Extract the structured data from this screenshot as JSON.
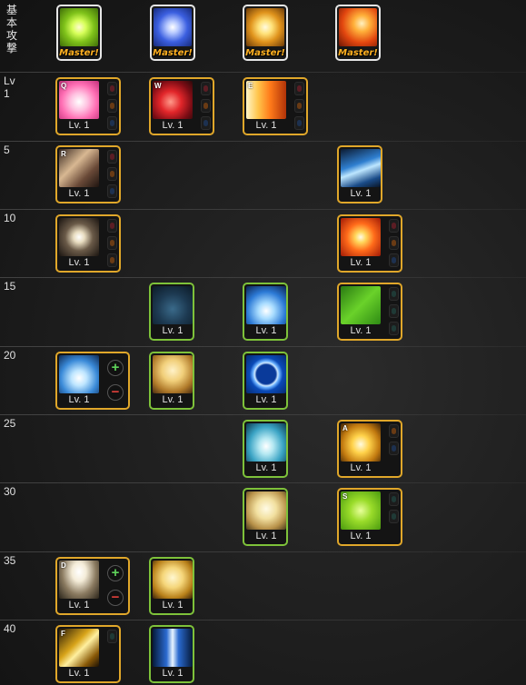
{
  "header": {
    "label_chars": [
      "基",
      "本",
      "攻",
      "撃"
    ]
  },
  "master_label": "Master!",
  "lv_prefix": "Lv",
  "levels": [
    {
      "label": "1"
    },
    {
      "label": "5"
    },
    {
      "label": "10"
    },
    {
      "label": "15"
    },
    {
      "label": "20"
    },
    {
      "label": "25"
    },
    {
      "label": "30"
    },
    {
      "label": "35"
    },
    {
      "label": "40"
    }
  ],
  "skills": [
    {
      "level": "Lv. 1",
      "key": "Q",
      "art": "heart-icon"
    },
    {
      "level": "Lv. 1",
      "key": "W",
      "art": "rose-icon"
    },
    {
      "level": "Lv. 1",
      "key": "E",
      "art": "fire-burst-icon"
    },
    {
      "level": "Lv. 1",
      "key": "R",
      "art": "swords-icon"
    },
    {
      "level": "Lv. 1",
      "key": "",
      "art": "blue-slash-icon"
    },
    {
      "level": "Lv. 1",
      "key": "",
      "art": "light-orb-icon"
    },
    {
      "level": "Lv. 1",
      "key": "",
      "art": "explosion-icon"
    },
    {
      "level": "Lv. 1",
      "key": "",
      "art": "rabbit-silhouette-icon"
    },
    {
      "level": "Lv. 1",
      "key": "",
      "art": "ice-burst-icon"
    },
    {
      "level": "Lv. 1",
      "key": "",
      "art": "heal-plus-icon"
    },
    {
      "level": "Lv. 1",
      "key": "",
      "art": "ice-spikes-icon"
    },
    {
      "level": "Lv. 1",
      "key": "",
      "art": "bunny-girl-icon"
    },
    {
      "level": "Lv. 1",
      "key": "",
      "art": "ring-icon"
    },
    {
      "level": "Lv. 1",
      "key": "",
      "art": "ice-field-icon"
    },
    {
      "level": "Lv. 1",
      "key": "A",
      "art": "golden-blast-icon"
    },
    {
      "level": "Lv. 1",
      "key": "",
      "art": "bunny-angel-icon"
    },
    {
      "level": "Lv. 1",
      "key": "S",
      "art": "big-plus-icon"
    },
    {
      "level": "Lv. 1",
      "key": "D",
      "art": "light-rays-icon"
    },
    {
      "level": "Lv. 1",
      "key": "",
      "art": "bunny-glow-icon"
    },
    {
      "level": "Lv. 1",
      "key": "F",
      "art": "gold-strike-icon"
    },
    {
      "level": "Lv. 1",
      "key": "",
      "art": "light-pillar-icon"
    }
  ],
  "plus_symbol": "+",
  "minus_symbol": "−"
}
